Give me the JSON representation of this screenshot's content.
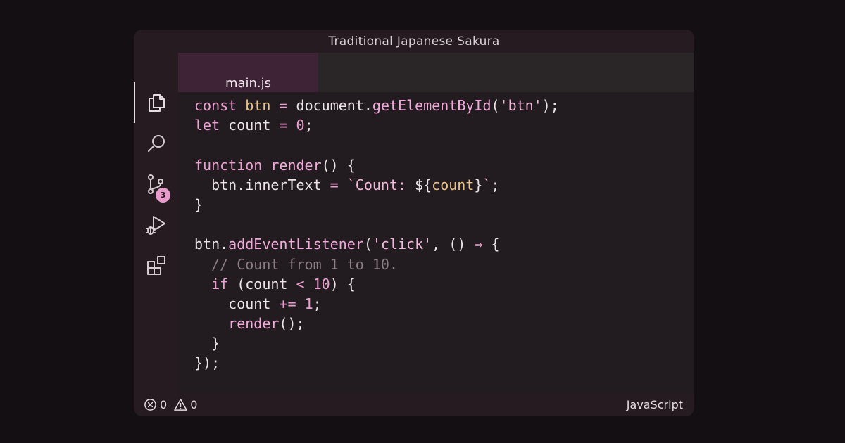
{
  "window": {
    "title": "Traditional Japanese Sakura"
  },
  "activity_bar": {
    "items": [
      {
        "icon": "files-icon"
      },
      {
        "icon": "search-icon"
      },
      {
        "icon": "source-control-icon",
        "badge": "3"
      },
      {
        "icon": "run-debug-icon"
      },
      {
        "icon": "extensions-icon"
      }
    ]
  },
  "tabs": [
    {
      "label": "main.js"
    }
  ],
  "code": {
    "language": "JavaScript",
    "lines": [
      [
        [
          "kw",
          "const"
        ],
        [
          "plain",
          " "
        ],
        [
          "var",
          "btn"
        ],
        [
          "plain",
          " "
        ],
        [
          "op",
          "="
        ],
        [
          "plain",
          " document."
        ],
        [
          "fn",
          "getElementById"
        ],
        [
          "plain",
          "("
        ],
        [
          "str",
          "'btn'"
        ],
        [
          "plain",
          ");"
        ]
      ],
      [
        [
          "kw",
          "let"
        ],
        [
          "plain",
          " count "
        ],
        [
          "op",
          "="
        ],
        [
          "plain",
          " "
        ],
        [
          "num",
          "0"
        ],
        [
          "plain",
          ";"
        ]
      ],
      [],
      [
        [
          "kw",
          "function"
        ],
        [
          "plain",
          " "
        ],
        [
          "fn",
          "render"
        ],
        [
          "plain",
          "() {"
        ]
      ],
      [
        [
          "plain",
          "  btn.innerText "
        ],
        [
          "op",
          "="
        ],
        [
          "plain",
          " "
        ],
        [
          "str",
          "`Count: "
        ],
        [
          "plain",
          "${"
        ],
        [
          "var",
          "count"
        ],
        [
          "plain",
          "}"
        ],
        [
          "str",
          "`"
        ],
        [
          "plain",
          ";"
        ]
      ],
      [
        [
          "plain",
          "}"
        ]
      ],
      [],
      [
        [
          "plain",
          "btn."
        ],
        [
          "fn",
          "addEventListener"
        ],
        [
          "plain",
          "("
        ],
        [
          "str",
          "'click'"
        ],
        [
          "plain",
          ", () "
        ],
        [
          "op",
          "⇒"
        ],
        [
          "plain",
          " {"
        ]
      ],
      [
        [
          "plain",
          "  "
        ],
        [
          "cm",
          "// Count from 1 to 10."
        ]
      ],
      [
        [
          "plain",
          "  "
        ],
        [
          "kw",
          "if"
        ],
        [
          "plain",
          " (count "
        ],
        [
          "op",
          "<"
        ],
        [
          "plain",
          " "
        ],
        [
          "num",
          "10"
        ],
        [
          "plain",
          ") {"
        ]
      ],
      [
        [
          "plain",
          "    count "
        ],
        [
          "op",
          "+="
        ],
        [
          "plain",
          " "
        ],
        [
          "num",
          "1"
        ],
        [
          "plain",
          ";"
        ]
      ],
      [
        [
          "plain",
          "    "
        ],
        [
          "fn",
          "render"
        ],
        [
          "plain",
          "();"
        ]
      ],
      [
        [
          "plain",
          "  }"
        ]
      ],
      [
        [
          "plain",
          "});"
        ]
      ]
    ]
  },
  "status_bar": {
    "errors": "0",
    "warnings": "0",
    "language": "JavaScript"
  },
  "colors": {
    "accent": "#e79ccc",
    "tab_underline": "#e3c48f",
    "keyword": "#ee9fd2",
    "variable": "#e8c48b"
  }
}
